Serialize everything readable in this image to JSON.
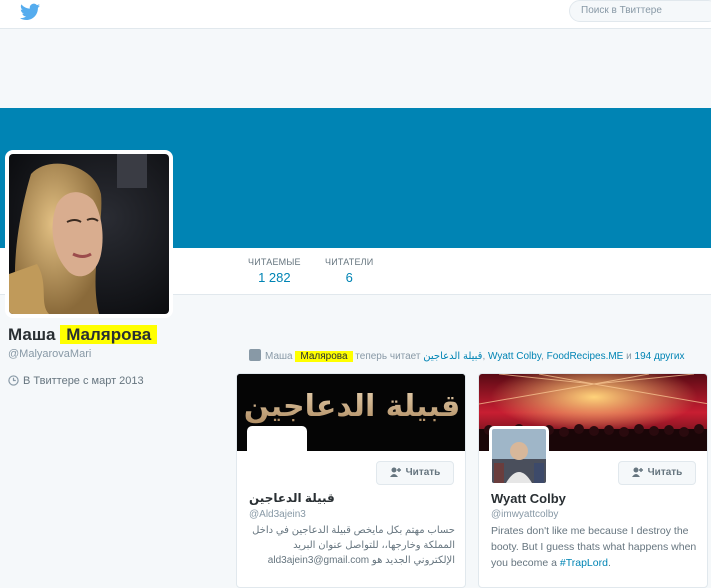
{
  "search": {
    "placeholder": "Поиск в Твиттере"
  },
  "stats": [
    {
      "label": "ЧИТАЕМЫЕ",
      "value": "1 282"
    },
    {
      "label": "ЧИТАТЕЛИ",
      "value": "6"
    }
  ],
  "profile": {
    "first_name": "Маша",
    "last_name": "Малярова",
    "handle": "@MalyarovaMari",
    "joined": "В Твиттере с март 2013"
  },
  "activity": {
    "first_name": "Маша",
    "last_name": "Малярова",
    "verb": "теперь читает",
    "link1": "قبيلة الدعاجين",
    "link2": "Wyatt Colby",
    "link3": "FoodRecipes.ME",
    "and": "и",
    "others": "194 других"
  },
  "cards": [
    {
      "banner_text": "قبيلة الدعاجين",
      "follow_label": "Читать",
      "name": "قبيلة الدعاجين",
      "handle": "@Ald3ajein3",
      "bio": "حساب مهتم بكل مايخص قبيلة الدعاجين في داخل المملكة وخارجها،، للتواصل عنوان البريد الإلكتروني الجديد هو ald3ajein3@gmail.com"
    },
    {
      "follow_label": "Читать",
      "name": "Wyatt Colby",
      "handle": "@imwyattcolby",
      "bio": "Pirates don't like me because I destroy the booty. But I guess thats what happens when you become a",
      "hashtag": "#TrapLord",
      "bio_end": "."
    }
  ],
  "colors": {
    "accent": "#0084b4",
    "banner": "#0084b4",
    "highlight": "#ffff00"
  },
  "icons": [
    "twitter-bird-icon",
    "calendar-icon",
    "person-icon",
    "follow-icon"
  ]
}
